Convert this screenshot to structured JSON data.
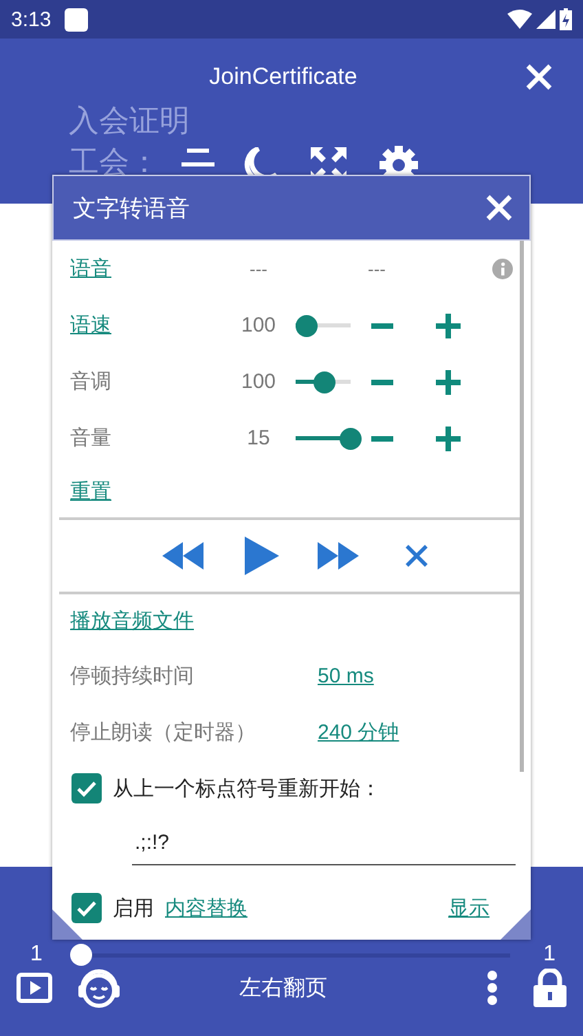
{
  "status_bar": {
    "time": "3:13"
  },
  "app_bar": {
    "title": "JoinCertificate",
    "background_lines": [
      "入会证明",
      "工会："
    ]
  },
  "tts_dialog": {
    "title": "文字转语音",
    "voice": {
      "label": "语音",
      "value_1": "---",
      "value_2": "---"
    },
    "sliders": [
      {
        "label": "语速",
        "link": true,
        "reading": "100",
        "level": 0.2
      },
      {
        "label": "音调",
        "link": false,
        "reading": "100",
        "level": 0.52
      },
      {
        "label": "音量",
        "link": false,
        "reading": "15",
        "level": 1
      }
    ],
    "reset": "重置",
    "play_audio_file": "播放音频文件",
    "settings": [
      {
        "label": "停顿持续时间",
        "value": "50 ms"
      },
      {
        "label": "停止朗读（定时器）",
        "value": "240 分钟"
      }
    ],
    "restart_option": {
      "label": "从上一个标点符号重新开始：",
      "checked": true,
      "value": ".;:!?"
    },
    "replace_option": {
      "label": "启用",
      "link": "内容替换",
      "checked": true,
      "show": "显示"
    }
  },
  "bottom_bar": {
    "page_start": "1",
    "page_end": "1",
    "level": 0,
    "mode": "左右翻页"
  }
}
